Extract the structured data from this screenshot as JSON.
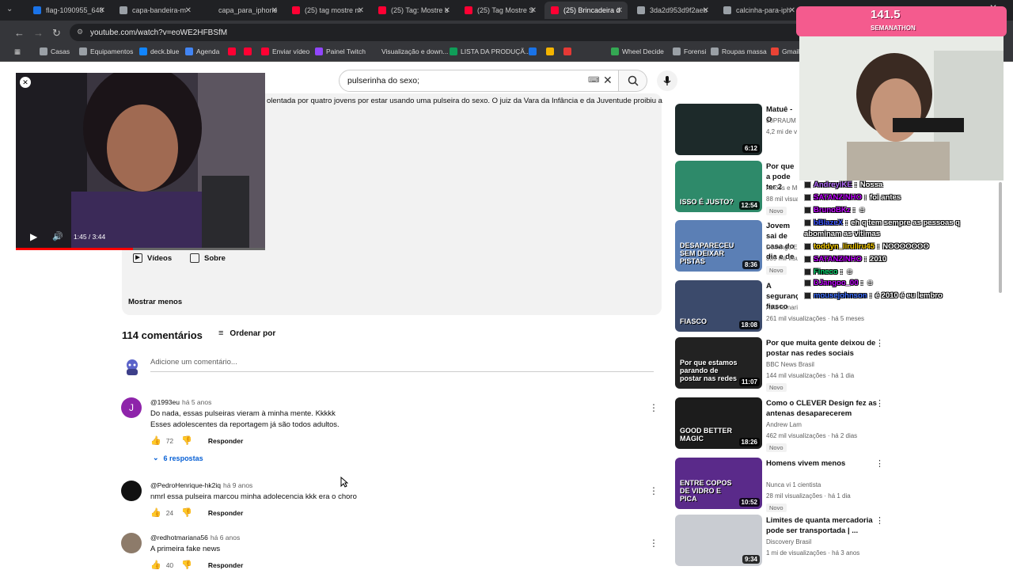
{
  "browser": {
    "tabs": [
      {
        "label": "flag-1090955_640",
        "favicon_color": "#1a73e8"
      },
      {
        "label": "capa-bandeira-m",
        "favicon_color": "#9aa0a6"
      },
      {
        "label": "capa_para_iphone",
        "favicon_color": "#202124"
      },
      {
        "label": "(25) tag mostre m",
        "favicon_color": "#ff0033"
      },
      {
        "label": "(25) Tag: Mostre s",
        "favicon_color": "#ff0033"
      },
      {
        "label": "(25) Tag Mostre S",
        "favicon_color": "#ff0033"
      },
      {
        "label": "(25) Brincadeira d",
        "favicon_color": "#ff0033",
        "active": true
      },
      {
        "label": "3da2d953d9f2aeb",
        "favicon_color": "#9aa0a6"
      },
      {
        "label": "calcinha-para-iph",
        "favicon_color": "#9aa0a6"
      }
    ],
    "url": "youtube.com/watch?v=eoWE2HFBSfM",
    "bookmarks": [
      {
        "label": "Casas",
        "color": "#9aa0a6"
      },
      {
        "label": "Equipamentos",
        "color": "#9aa0a6"
      },
      {
        "label": "deck.blue",
        "color": "#1185fe"
      },
      {
        "label": "Agenda",
        "color": "#4285f4"
      },
      {
        "label": "",
        "color": "#ff0033"
      },
      {
        "label": "",
        "color": "#ff0033"
      },
      {
        "label": "Enviar vídeo",
        "color": "#ff0033"
      },
      {
        "label": "Painel Twitch",
        "color": "#9146ff"
      },
      {
        "label": "Visualização e down...",
        "color": "#35363a"
      },
      {
        "label": "LISTA DA PRODUÇÃ...",
        "color": "#0f9d58"
      },
      {
        "label": "",
        "color": "#1a73e8"
      },
      {
        "label": "",
        "color": "#f4b400"
      },
      {
        "label": "",
        "color": "#e53935"
      },
      {
        "label": "Wheel Decide",
        "color": "#34a853"
      },
      {
        "label": "Forensi",
        "color": "#9aa0a6"
      },
      {
        "label": "Roupas massa",
        "color": "#9aa0a6"
      },
      {
        "label": "Gmail",
        "color": "#ea4335"
      }
    ]
  },
  "youtube": {
    "search_query": "pulserinha do sexo;",
    "description_snippet": "olentada por quatro jovens por estar usando uma pulseira do sexo. O juiz da Vara da Infância e da Juventude proibiu a",
    "desc_buttons": {
      "videos": "Vídeos",
      "about": "Sobre"
    },
    "show_less": "Mostrar menos",
    "miniplayer": {
      "time": "1:45 / 3:44",
      "progress": 0.47
    },
    "comments_count": "114 comentários",
    "sort_label": "Ordenar por",
    "add_comment_placeholder": "Adicione um comentário...",
    "comments": [
      {
        "handle": "@1993eu",
        "time": "há 5 anos",
        "avatar_letter": "J",
        "avatar_color": "#8e24aa",
        "lines": [
          "Do nada, essas pulseiras vieram à minha mente. Kkkkk",
          "Esses adolescentes da reportagem já são todos adultos."
        ],
        "likes": "72",
        "reply": "Responder",
        "replies": "6 respostas"
      },
      {
        "handle": "@PedroHenrique-hk2iq",
        "time": "há 9 anos",
        "avatar_letter": "",
        "avatar_color": "#111111",
        "lines": [
          "nmrl essa pulseira marcou minha adolecencia kkk era o choro"
        ],
        "likes": "24",
        "reply": "Responder"
      },
      {
        "handle": "@redhotmariana56",
        "time": "há 6 anos",
        "avatar_letter": "",
        "avatar_color": "#8d7b6a",
        "lines": [
          "A primeira fake news"
        ],
        "likes": "40",
        "reply": "Responder"
      }
    ],
    "recommendations": [
      {
        "title": "Matuê - O",
        "channel": "30PRAUM",
        "meta": "4,2 mi de v",
        "duration": "6:12",
        "thumb_color": "#1d2a2a",
        "badge": ""
      },
      {
        "title": "Por que a pode ter 2",
        "channel": "Aviões e Mú",
        "meta": "88 mil visua",
        "duration": "12:54",
        "thumb_color": "#2e8a6a",
        "thumb_text": "ISSO É JUSTO?",
        "badge": "Novo"
      },
      {
        "title": "Jovem sai de casa do dia e de",
        "channel": "Domingo Esp",
        "meta": "339 mil visu",
        "duration": "8:36",
        "thumb_color": "#5b7fb5",
        "thumb_text": "DESAPARECEU SEM DEIXAR PISTAS",
        "badge": "Novo"
      },
      {
        "title": "A seguranç fiasco",
        "channel": "Atila Iamarino",
        "meta": "261 mil visualizações · há 5 meses",
        "duration": "18:08",
        "thumb_color": "#3b4a6b",
        "thumb_text": "FIASCO",
        "badge": ""
      },
      {
        "title": "Por que muita gente deixou de postar nas redes sociais",
        "channel": "BBC News Brasil",
        "meta": "144 mil visualizações · há 1 dia",
        "duration": "11:07",
        "thumb_color": "#222222",
        "thumb_text": "Por que estamos parando de postar nas redes",
        "badge": "Novo"
      },
      {
        "title": "Como o CLEVER Design fez as antenas desaparecerem",
        "channel": "Andrew Lam",
        "meta": "462 mil visualizações · há 2 dias",
        "duration": "18:26",
        "thumb_color": "#1c1c1c",
        "thumb_text": "GOOD  BETTER  MAGIC",
        "badge": "Novo"
      },
      {
        "title": "Homens vivem menos",
        "channel": "Nunca vi 1 cientista",
        "meta": "28 mil visualizações · há 1 dia",
        "duration": "10:52",
        "thumb_color": "#5a2a8a",
        "thumb_text": "ENTRE COPOS DE VIDRO E PICA",
        "badge": "Novo"
      },
      {
        "title": "Limites de quanta mercadoria pode ser transportada | ...",
        "channel": "Discovery Brasil",
        "meta": "1 mi de visualizações · há 3 anos",
        "duration": "9:34",
        "thumb_color": "#c9ccd2",
        "badge": ""
      }
    ]
  },
  "stream": {
    "title": "141.5",
    "subtitle": "SEMANATHON",
    "chat": [
      {
        "user": "AndreyiKE",
        "user_color": "#b56cff",
        "msg": "Nossa"
      },
      {
        "user": "SATANZINHO",
        "user_color": "#c000ff",
        "msg": "foi antes"
      },
      {
        "user": "BrunoBKz",
        "user_color": "#c000ff",
        "msg": "☺"
      },
      {
        "user": "bBlazeX",
        "user_color": "#3a52ff",
        "msg": "eh q tem sempre as pessoas q"
      },
      {
        "user": "",
        "user_color": "#ffffff",
        "msg": "abominam as vitimas"
      },
      {
        "user": "toddyn_liruliru45",
        "user_color": "#ffd200",
        "msg": "NOOOOOOO"
      },
      {
        "user": "SATANZINHO",
        "user_color": "#c000ff",
        "msg": "2010"
      },
      {
        "user": "Fineco",
        "user_color": "#00d26a",
        "msg": "☺"
      },
      {
        "user": "DJangoo_00",
        "user_color": "#c000ff",
        "msg": "☺"
      },
      {
        "user": "mousejohnson",
        "user_color": "#3a6cff",
        "msg": "é 2010 é eu lembro"
      }
    ]
  }
}
